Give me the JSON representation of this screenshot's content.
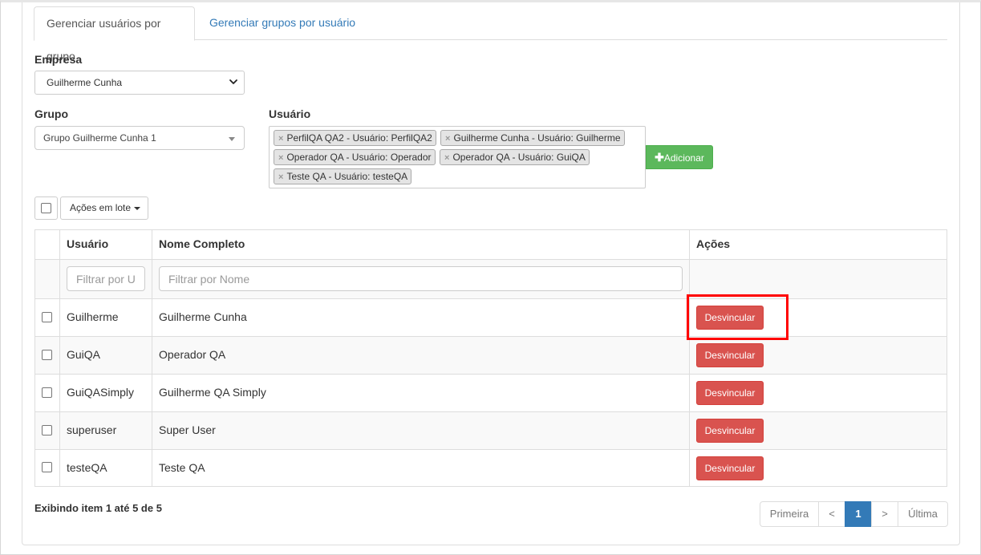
{
  "tabs": [
    {
      "label": "Gerenciar usuários por grupo",
      "active": true
    },
    {
      "label": "Gerenciar grupos por usuário",
      "active": false
    }
  ],
  "empresa": {
    "label": "Empresa",
    "value": "Guilherme Cunha"
  },
  "grupo": {
    "label": "Grupo",
    "value": "Grupo Guilherme Cunha 1"
  },
  "usuario": {
    "label": "Usuário",
    "chips": [
      "PerfilQA QA2 - Usuário: PerfilQA2",
      "Guilherme Cunha - Usuário: Guilherme",
      "Operador QA - Usuário: Operador",
      "Operador QA - Usuário: GuiQA",
      "Teste QA - Usuário: testeQA"
    ],
    "remove_glyph": "×"
  },
  "add_button": {
    "label": "Adicionar",
    "icon": "plus-icon"
  },
  "batch_actions": {
    "label": "Ações em lote"
  },
  "table": {
    "headers": {
      "usuario": "Usuário",
      "nome": "Nome Completo",
      "acoes": "Ações"
    },
    "filters": {
      "usuario_placeholder": "Filtrar por U",
      "nome_placeholder": "Filtrar por Nome"
    },
    "rows": [
      {
        "usuario": "Guilherme",
        "nome": "Guilherme Cunha",
        "action": "Desvincular"
      },
      {
        "usuario": "GuiQA",
        "nome": "Operador QA",
        "action": "Desvincular"
      },
      {
        "usuario": "GuiQASimply",
        "nome": "Guilherme QA Simply",
        "action": "Desvincular"
      },
      {
        "usuario": "superuser",
        "nome": "Super User",
        "action": "Desvincular"
      },
      {
        "usuario": "testeQA",
        "nome": "Teste QA",
        "action": "Desvincular"
      }
    ]
  },
  "footer": {
    "summary": "Exibindo item 1 até 5 de 5"
  },
  "pagination": {
    "first": "Primeira",
    "prev": "<",
    "current": "1",
    "next": ">",
    "last": "Última"
  },
  "colors": {
    "primary": "#337ab7",
    "success": "#5cb85c",
    "danger": "#d9534f",
    "highlight": "#ff0000"
  }
}
